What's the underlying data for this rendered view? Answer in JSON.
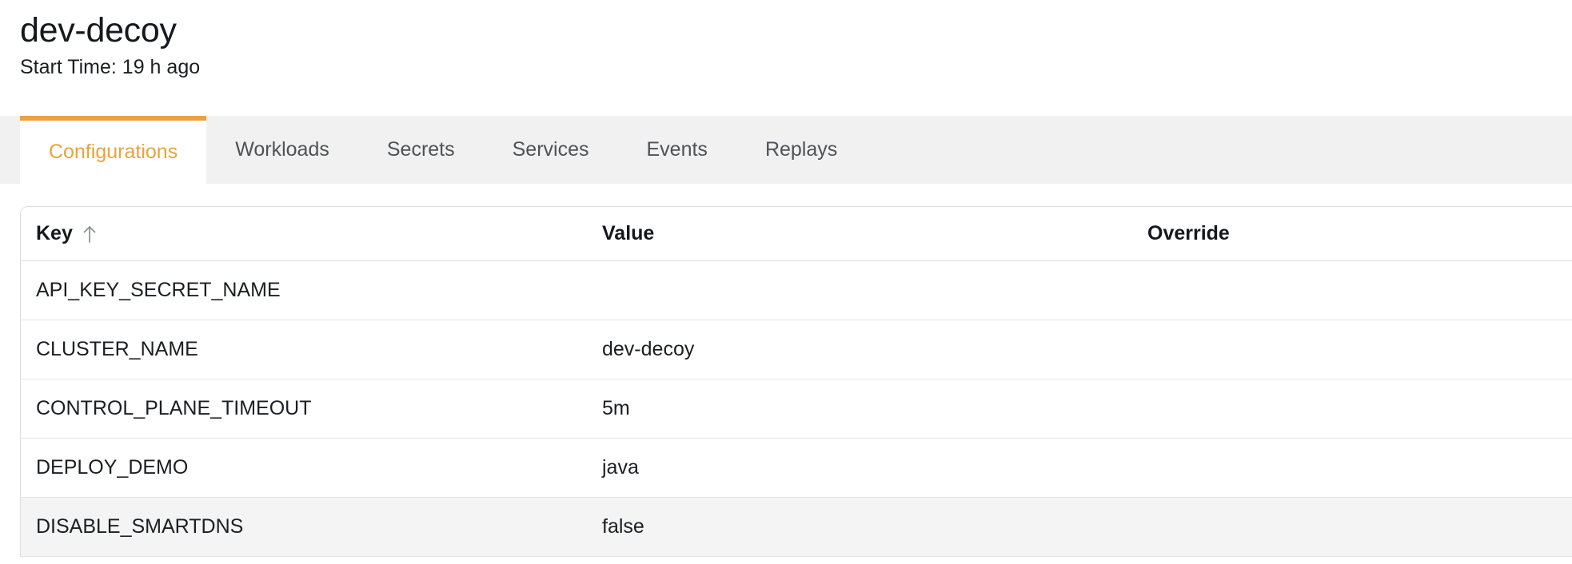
{
  "header": {
    "title": "dev-decoy",
    "subtitle": "Start Time: 19 h ago"
  },
  "tabs": [
    {
      "label": "Configurations",
      "active": true
    },
    {
      "label": "Workloads",
      "active": false
    },
    {
      "label": "Secrets",
      "active": false
    },
    {
      "label": "Services",
      "active": false
    },
    {
      "label": "Events",
      "active": false
    },
    {
      "label": "Replays",
      "active": false
    }
  ],
  "table": {
    "columns": [
      {
        "label": "Key",
        "sort": "ascending",
        "sort_icon": "arrow-up-icon"
      },
      {
        "label": "Value",
        "sort": "none"
      },
      {
        "label": "Override",
        "sort": "none"
      }
    ],
    "rows": [
      {
        "key": "API_KEY_SECRET_NAME",
        "value": "",
        "override": "",
        "highlight": false
      },
      {
        "key": "CLUSTER_NAME",
        "value": "dev-decoy",
        "override": "",
        "highlight": false
      },
      {
        "key": "CONTROL_PLANE_TIMEOUT",
        "value": "5m",
        "override": "",
        "highlight": false
      },
      {
        "key": "DEPLOY_DEMO",
        "value": "java",
        "override": "",
        "highlight": false
      },
      {
        "key": "DISABLE_SMARTDNS",
        "value": "false",
        "override": "",
        "highlight": true
      }
    ]
  },
  "colors": {
    "accent": "#e8a33d",
    "tabbar_bg": "#f1f1f1",
    "row_highlight": "#f4f4f4",
    "border": "#dcdcdc",
    "text": "#1c1e23",
    "tab_inactive_text": "#4f5256"
  }
}
